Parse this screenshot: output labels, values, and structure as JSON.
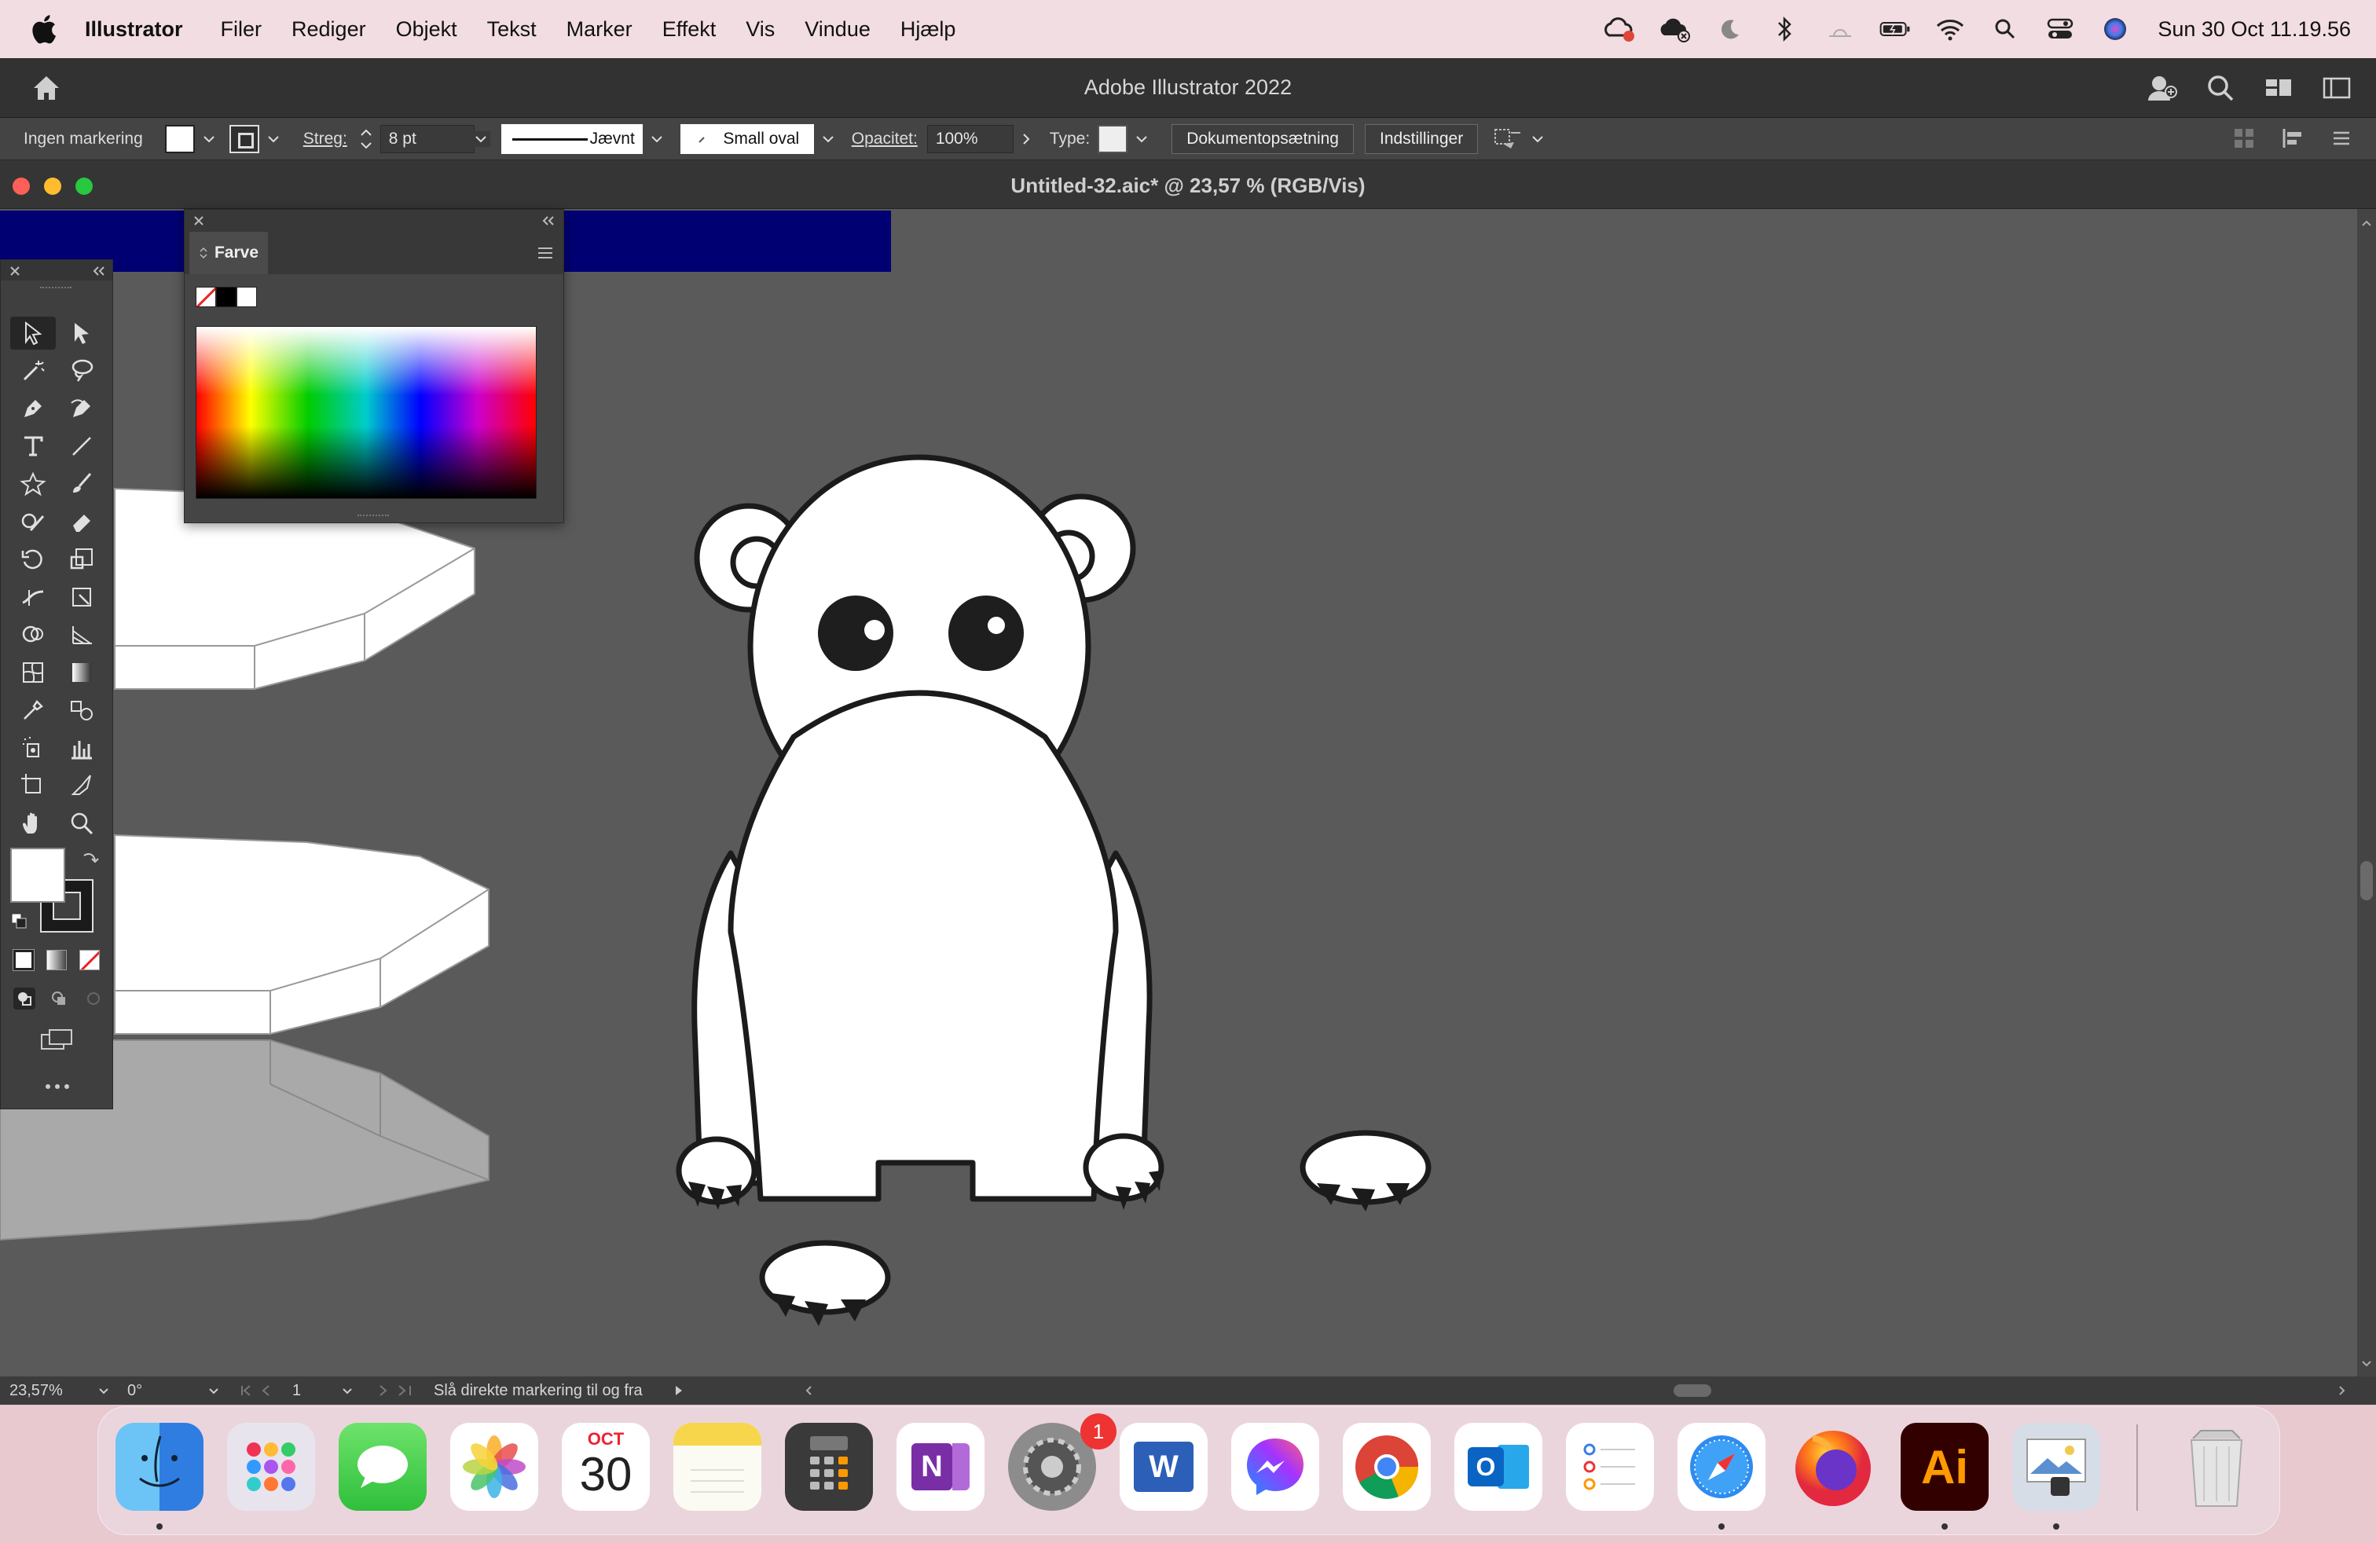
{
  "menubar": {
    "app_name": "Illustrator",
    "items": [
      "Filer",
      "Rediger",
      "Objekt",
      "Tekst",
      "Marker",
      "Effekt",
      "Vis",
      "Vindue",
      "Hjælp"
    ],
    "clock": "Sun 30 Oct  11.19.56"
  },
  "appbar": {
    "title": "Adobe Illustrator 2022"
  },
  "control": {
    "selection_label": "Ingen markering",
    "stroke_label": "Streg:",
    "stroke_value": "8 pt",
    "profile_label": "Jævnt",
    "brush_label": "Small oval",
    "opacity_label": "Opacitet:",
    "opacity_value": "100%",
    "style_label": "Type:",
    "doc_setup_button": "Dokumentopsætning",
    "prefs_button": "Indstillinger"
  },
  "document": {
    "title": "Untitled-32.aic* @ 23,57 % (RGB/Vis)"
  },
  "color_panel": {
    "tab_label": "Farve"
  },
  "status": {
    "zoom": "23,57%",
    "rotation": "0°",
    "artboard": "1",
    "message": "Slå direkte markering til og fra"
  },
  "dock": {
    "calendar_month": "OCT",
    "calendar_day": "30",
    "settings_badge": "1",
    "illustrator_label": "Ai",
    "word_label": "W",
    "onenote_label": "N",
    "outlook_label": "O"
  },
  "colors": {
    "canvas": "#5a5a5a",
    "panel": "#3f3f3f",
    "navy_bar": "#000073",
    "menubar": "#f2dde3"
  }
}
